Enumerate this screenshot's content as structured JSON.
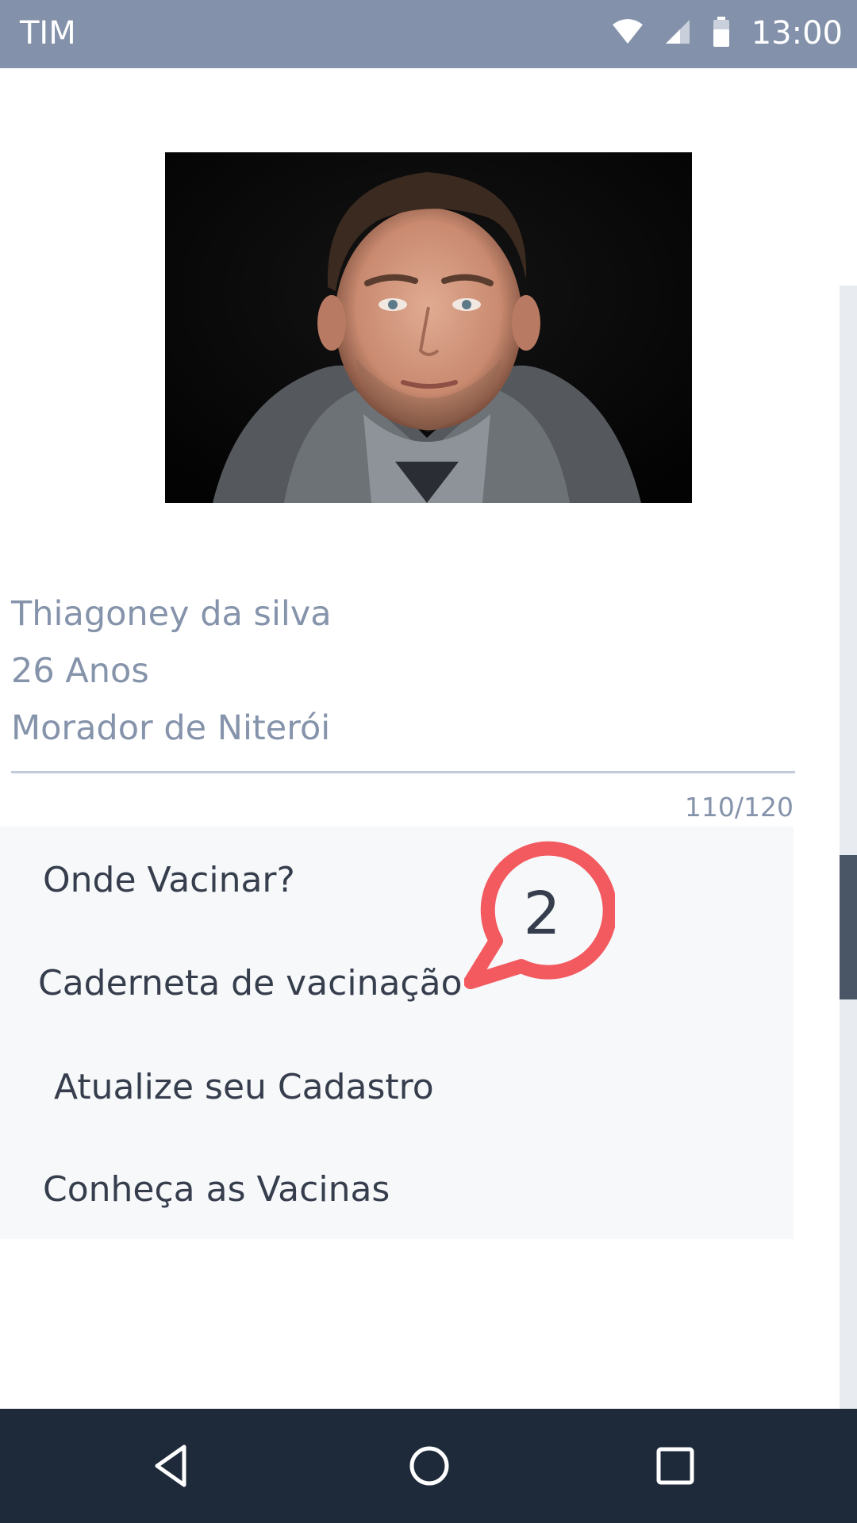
{
  "status_bar": {
    "carrier": "TIM",
    "time": "13:00",
    "icons": [
      "wifi-icon",
      "signal-icon",
      "battery-icon"
    ]
  },
  "profile": {
    "photo": "person-portrait",
    "name": "Thiagoney da silva",
    "age": "26 Anos",
    "location": "Morador de Niterói",
    "counter": "110/120"
  },
  "menu": {
    "items": [
      {
        "label": "Onde Vacinar?"
      },
      {
        "label": "Caderneta de vacinação"
      },
      {
        "label": "Atualize seu Cadastro"
      },
      {
        "label": "Conheça as Vacinas"
      }
    ]
  },
  "notification": {
    "count": "2",
    "icon": "chat-bubble-icon",
    "color": "#f25a5f"
  },
  "nav_bar": {
    "buttons": [
      "back-icon",
      "home-icon",
      "recents-icon"
    ]
  },
  "colors": {
    "status_bar": "#8392aa",
    "text_muted": "#8593ab",
    "text_dark": "#363e4d",
    "nav_bar": "#1e2a3a",
    "menu_bg": "#f7f8fa"
  }
}
